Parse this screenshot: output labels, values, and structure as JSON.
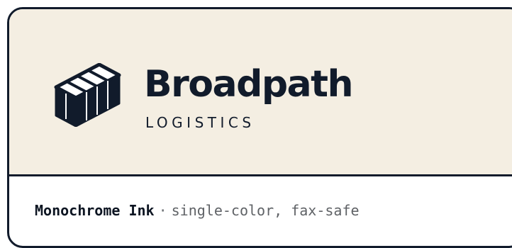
{
  "brand": {
    "name": "Broadpath",
    "tagline": "LOGISTICS"
  },
  "variant": {
    "name": "Monochrome Ink",
    "separator": "·",
    "description": "single-color, fax-safe"
  },
  "colors": {
    "ink": "#111b2b",
    "paper": "#f4eee2",
    "muted": "#5f6266"
  },
  "icons": {
    "mark": "shipping-container-icon"
  }
}
